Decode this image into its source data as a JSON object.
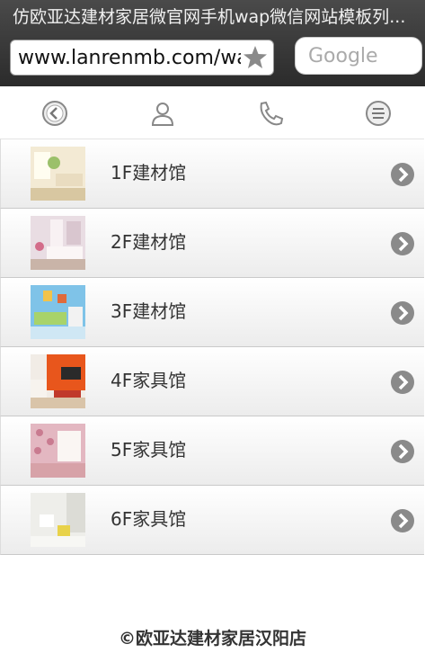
{
  "browser": {
    "page_title": "仿欧亚达建材家居微官网手机wap微信网站模板列...",
    "url": "www.lanrenmb.com/wap",
    "search_placeholder": "Google"
  },
  "toolbar": {
    "icons": [
      "back-icon",
      "user-icon",
      "phone-icon",
      "menu-icon"
    ]
  },
  "list": {
    "items": [
      {
        "label": "1F建材馆",
        "image": "bright-living-room"
      },
      {
        "label": "2F建材馆",
        "image": "pink-bedroom"
      },
      {
        "label": "3F建材馆",
        "image": "kids-room-blue"
      },
      {
        "label": "4F家具馆",
        "image": "orange-tv-wall"
      },
      {
        "label": "5F家具馆",
        "image": "floral-bedroom"
      },
      {
        "label": "6F家具馆",
        "image": "white-room"
      }
    ]
  },
  "footer": {
    "text": "©欧亚达建材家居汉阳店"
  }
}
